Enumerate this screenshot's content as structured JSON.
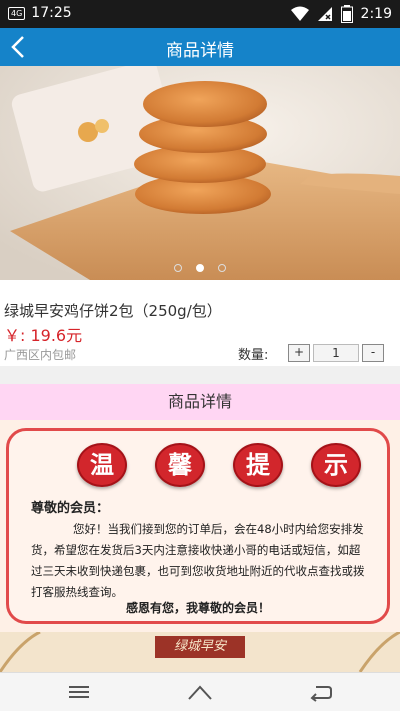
{
  "status_bar": {
    "network": "4G",
    "time": "17:25",
    "battery_time": "2:19"
  },
  "app_bar": {
    "title": "商品详情"
  },
  "product": {
    "name": "绿城早安鸡仔饼2包（250g/包）",
    "price": "￥: 19.6元",
    "shipping": "广西区内包邮",
    "quantity_label": "数量:",
    "quantity": "1",
    "plus_label": "+",
    "minus_label": "-"
  },
  "carousel": {
    "count": 3,
    "active_index": 1
  },
  "detail_tab": {
    "label": "商品详情"
  },
  "notice": {
    "badges": [
      "温",
      "馨",
      "提",
      "示"
    ],
    "greeting": "尊敬的会员：",
    "body": "您好！当我们接到您的订单后，会在48小时内给您安排发货，希望您在发货后3天内注意接收快递小哥的电话或短信，如超过三天未收到快递包裹，也可到您收货地址附近的代收点查找或拨打客服热线查询。",
    "closing": "感恩有您，我尊敬的会员！"
  },
  "banner": {
    "brand_text": "绿城早安"
  },
  "colors": {
    "app_bar": "#1583c9",
    "price": "#d6242a",
    "tab_bg": "#ffd6f3",
    "notice_border": "#e14a4a",
    "badge_red": "#d2262c"
  }
}
